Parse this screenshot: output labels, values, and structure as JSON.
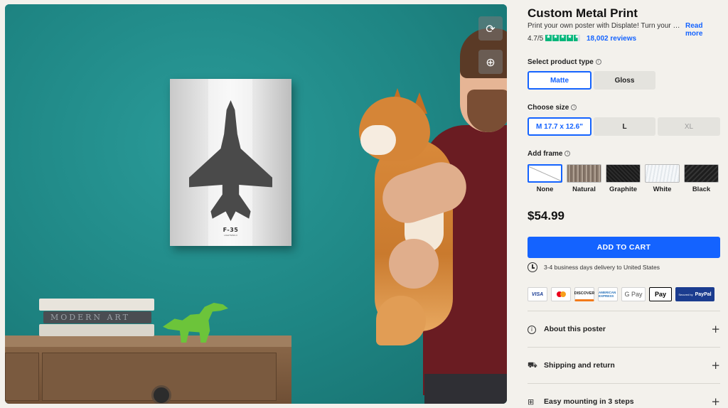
{
  "product": {
    "title": "Custom Metal Print",
    "description": "Print your own poster with Displate! Turn your favorite photos into metal posters",
    "read_more": "Read more",
    "rating": "4.7/5",
    "reviews": "18,002 reviews"
  },
  "hero": {
    "poster_title": "F-35",
    "poster_subtitle": "LIGHTNING II",
    "books_text": "MODERN ART",
    "refresh_icon": "refresh-icon",
    "zoom_icon": "zoom-in-icon"
  },
  "thumbnails": [
    "photo-wall",
    "poster-room",
    "video",
    "poster-dark",
    "poster-interior",
    "poster-living-room"
  ],
  "type": {
    "label": "Select product type",
    "options": [
      "Matte",
      "Gloss"
    ],
    "selected": "Matte"
  },
  "size": {
    "label": "Choose size",
    "options": [
      "M  17.7 x 12.6\"",
      "L",
      "XL"
    ],
    "selected": "M"
  },
  "frame": {
    "label": "Add frame",
    "options": [
      "None",
      "Natural",
      "Graphite",
      "White",
      "Black"
    ],
    "selected": "None"
  },
  "price": "$54.99",
  "cart": {
    "label": "ADD TO CART"
  },
  "delivery": "3-4 business days delivery to United States",
  "payments": {
    "visa": "VISA",
    "discover": "DISCOVER",
    "amex": "AMERICAN EXPRESS",
    "gpay": "G Pay",
    "apay": "Pay",
    "paypal_secured": "Secured by",
    "paypal": "PayPal"
  },
  "accordion": [
    {
      "label": "About this poster",
      "icon": "info-icon"
    },
    {
      "label": "Shipping and return",
      "icon": "truck-icon"
    },
    {
      "label": "Easy mounting in 3 steps",
      "icon": "mount-icon"
    }
  ],
  "colors": {
    "accent": "#1463ff",
    "trustpilot": "#00b67a",
    "wall": "#1f8c8c"
  }
}
